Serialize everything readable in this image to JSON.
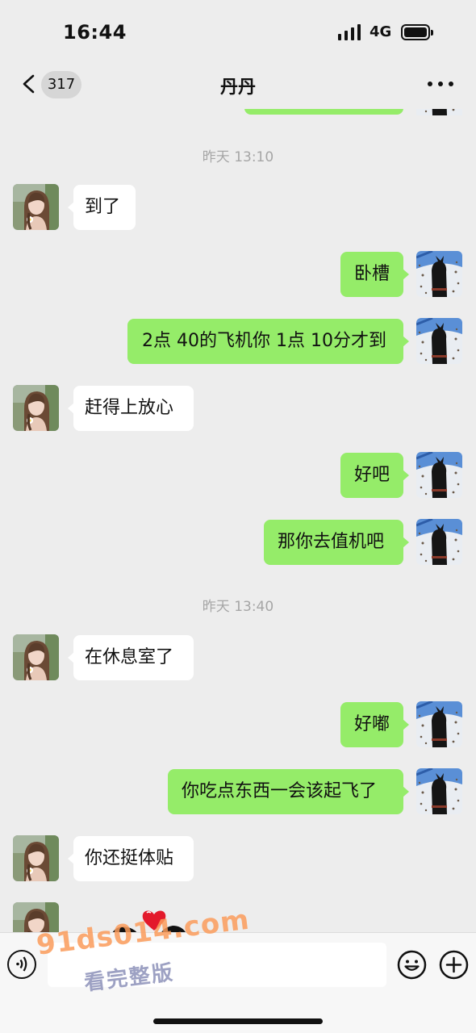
{
  "status_bar": {
    "time": "16:44",
    "network": "4G"
  },
  "nav": {
    "unread_count": "317",
    "contact_name": "丹丹",
    "icons": {
      "back": "chevron-left-icon",
      "more": "more-dots-icon"
    }
  },
  "colors": {
    "background": "#ededed",
    "incoming_bubble": "#ffffff",
    "outgoing_bubble": "#95ec69",
    "timestamp": "#a6a6a6"
  },
  "chat": {
    "timestamps": [
      "昨天 13:10",
      "昨天 13:40"
    ],
    "messages": [
      {
        "from": "contact",
        "text": "到了"
      },
      {
        "from": "me",
        "text": "卧槽"
      },
      {
        "from": "me",
        "text": "2点 40的飞机你 1点 10分才到"
      },
      {
        "from": "contact",
        "text": "赶得上放心"
      },
      {
        "from": "me",
        "text": "好吧"
      },
      {
        "from": "me",
        "text": "那你去值机吧"
      },
      {
        "from": "contact",
        "text": "在休息室了"
      },
      {
        "from": "me",
        "text": "好嘟"
      },
      {
        "from": "me",
        "text": "你吃点东西一会该起飞了"
      },
      {
        "from": "contact",
        "text": "你还挺体贴"
      }
    ],
    "last_message": {
      "from": "contact",
      "type": "sticker",
      "icon": "heart-sticker-icon"
    }
  },
  "input_bar": {
    "value": "",
    "icons": {
      "voice": "voice-icon",
      "emoji": "emoji-icon",
      "add": "plus-icon"
    }
  },
  "watermark": {
    "url": "91ds014.com",
    "cta": "看完整版"
  }
}
